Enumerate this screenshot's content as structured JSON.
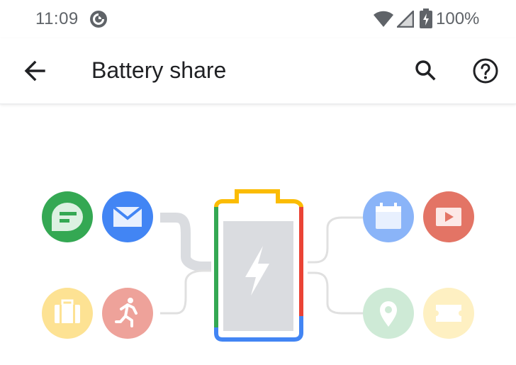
{
  "status_bar": {
    "time": "11:09",
    "battery_percent": "100%",
    "app_icon": "pocket-casts-icon",
    "wifi_icon": "wifi-icon",
    "signal_icon": "cell-signal-icon",
    "battery_icon": "battery-charging-icon"
  },
  "app_bar": {
    "title": "Battery share",
    "back_icon": "back-arrow-icon",
    "search_icon": "search-icon",
    "help_icon": "help-icon"
  },
  "illustration": {
    "left_icons": [
      "messages-icon",
      "email-icon",
      "briefcase-icon",
      "running-icon"
    ],
    "right_icons": [
      "calendar-icon",
      "video-icon",
      "maps-pin-icon",
      "ticket-icon"
    ],
    "battery_icon": "lightning-bolt-icon",
    "colors": {
      "green": "#34a853",
      "blue": "#4285f4",
      "yellow": "#fbbc04",
      "red": "#ea4335",
      "gray": "#dadce0"
    }
  }
}
